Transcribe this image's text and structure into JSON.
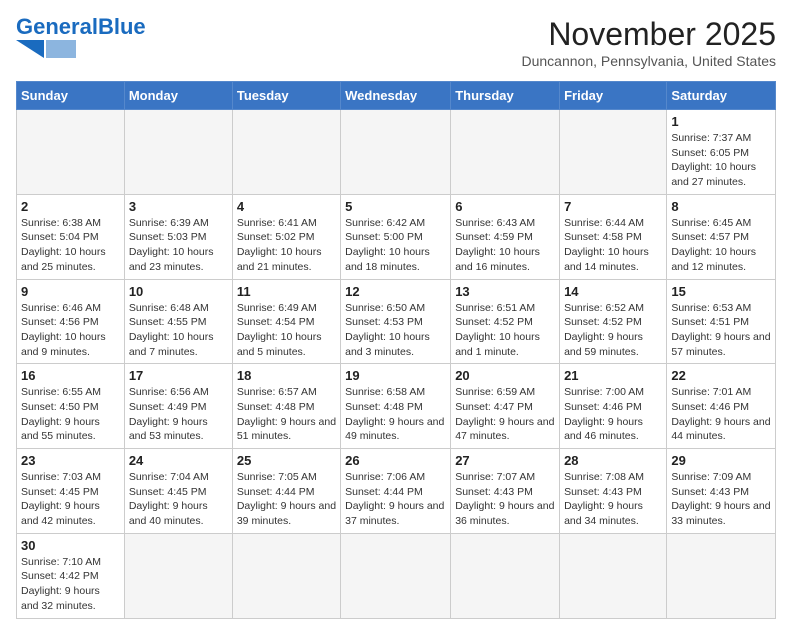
{
  "header": {
    "logo_general": "General",
    "logo_blue": "Blue",
    "month_title": "November 2025",
    "location": "Duncannon, Pennsylvania, United States"
  },
  "days_of_week": [
    "Sunday",
    "Monday",
    "Tuesday",
    "Wednesday",
    "Thursday",
    "Friday",
    "Saturday"
  ],
  "weeks": [
    [
      {
        "day": "",
        "info": ""
      },
      {
        "day": "",
        "info": ""
      },
      {
        "day": "",
        "info": ""
      },
      {
        "day": "",
        "info": ""
      },
      {
        "day": "",
        "info": ""
      },
      {
        "day": "",
        "info": ""
      },
      {
        "day": "1",
        "info": "Sunrise: 7:37 AM\nSunset: 6:05 PM\nDaylight: 10 hours and 27 minutes."
      }
    ],
    [
      {
        "day": "2",
        "info": "Sunrise: 6:38 AM\nSunset: 5:04 PM\nDaylight: 10 hours and 25 minutes."
      },
      {
        "day": "3",
        "info": "Sunrise: 6:39 AM\nSunset: 5:03 PM\nDaylight: 10 hours and 23 minutes."
      },
      {
        "day": "4",
        "info": "Sunrise: 6:41 AM\nSunset: 5:02 PM\nDaylight: 10 hours and 21 minutes."
      },
      {
        "day": "5",
        "info": "Sunrise: 6:42 AM\nSunset: 5:00 PM\nDaylight: 10 hours and 18 minutes."
      },
      {
        "day": "6",
        "info": "Sunrise: 6:43 AM\nSunset: 4:59 PM\nDaylight: 10 hours and 16 minutes."
      },
      {
        "day": "7",
        "info": "Sunrise: 6:44 AM\nSunset: 4:58 PM\nDaylight: 10 hours and 14 minutes."
      },
      {
        "day": "8",
        "info": "Sunrise: 6:45 AM\nSunset: 4:57 PM\nDaylight: 10 hours and 12 minutes."
      }
    ],
    [
      {
        "day": "9",
        "info": "Sunrise: 6:46 AM\nSunset: 4:56 PM\nDaylight: 10 hours and 9 minutes."
      },
      {
        "day": "10",
        "info": "Sunrise: 6:48 AM\nSunset: 4:55 PM\nDaylight: 10 hours and 7 minutes."
      },
      {
        "day": "11",
        "info": "Sunrise: 6:49 AM\nSunset: 4:54 PM\nDaylight: 10 hours and 5 minutes."
      },
      {
        "day": "12",
        "info": "Sunrise: 6:50 AM\nSunset: 4:53 PM\nDaylight: 10 hours and 3 minutes."
      },
      {
        "day": "13",
        "info": "Sunrise: 6:51 AM\nSunset: 4:52 PM\nDaylight: 10 hours and 1 minute."
      },
      {
        "day": "14",
        "info": "Sunrise: 6:52 AM\nSunset: 4:52 PM\nDaylight: 9 hours and 59 minutes."
      },
      {
        "day": "15",
        "info": "Sunrise: 6:53 AM\nSunset: 4:51 PM\nDaylight: 9 hours and 57 minutes."
      }
    ],
    [
      {
        "day": "16",
        "info": "Sunrise: 6:55 AM\nSunset: 4:50 PM\nDaylight: 9 hours and 55 minutes."
      },
      {
        "day": "17",
        "info": "Sunrise: 6:56 AM\nSunset: 4:49 PM\nDaylight: 9 hours and 53 minutes."
      },
      {
        "day": "18",
        "info": "Sunrise: 6:57 AM\nSunset: 4:48 PM\nDaylight: 9 hours and 51 minutes."
      },
      {
        "day": "19",
        "info": "Sunrise: 6:58 AM\nSunset: 4:48 PM\nDaylight: 9 hours and 49 minutes."
      },
      {
        "day": "20",
        "info": "Sunrise: 6:59 AM\nSunset: 4:47 PM\nDaylight: 9 hours and 47 minutes."
      },
      {
        "day": "21",
        "info": "Sunrise: 7:00 AM\nSunset: 4:46 PM\nDaylight: 9 hours and 46 minutes."
      },
      {
        "day": "22",
        "info": "Sunrise: 7:01 AM\nSunset: 4:46 PM\nDaylight: 9 hours and 44 minutes."
      }
    ],
    [
      {
        "day": "23",
        "info": "Sunrise: 7:03 AM\nSunset: 4:45 PM\nDaylight: 9 hours and 42 minutes."
      },
      {
        "day": "24",
        "info": "Sunrise: 7:04 AM\nSunset: 4:45 PM\nDaylight: 9 hours and 40 minutes."
      },
      {
        "day": "25",
        "info": "Sunrise: 7:05 AM\nSunset: 4:44 PM\nDaylight: 9 hours and 39 minutes."
      },
      {
        "day": "26",
        "info": "Sunrise: 7:06 AM\nSunset: 4:44 PM\nDaylight: 9 hours and 37 minutes."
      },
      {
        "day": "27",
        "info": "Sunrise: 7:07 AM\nSunset: 4:43 PM\nDaylight: 9 hours and 36 minutes."
      },
      {
        "day": "28",
        "info": "Sunrise: 7:08 AM\nSunset: 4:43 PM\nDaylight: 9 hours and 34 minutes."
      },
      {
        "day": "29",
        "info": "Sunrise: 7:09 AM\nSunset: 4:43 PM\nDaylight: 9 hours and 33 minutes."
      }
    ],
    [
      {
        "day": "30",
        "info": "Sunrise: 7:10 AM\nSunset: 4:42 PM\nDaylight: 9 hours and 32 minutes."
      },
      {
        "day": "",
        "info": ""
      },
      {
        "day": "",
        "info": ""
      },
      {
        "day": "",
        "info": ""
      },
      {
        "day": "",
        "info": ""
      },
      {
        "day": "",
        "info": ""
      },
      {
        "day": "",
        "info": ""
      }
    ]
  ]
}
